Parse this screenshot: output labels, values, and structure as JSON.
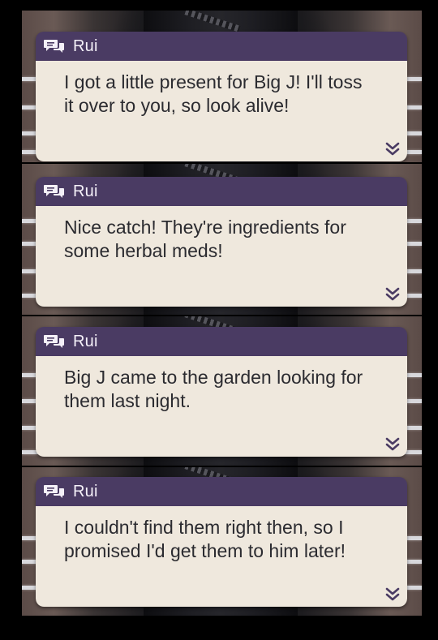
{
  "dialogs": [
    {
      "speaker": "Rui",
      "text": "I got a little present for Big J! I'll toss it over to you, so look alive!"
    },
    {
      "speaker": "Rui",
      "text": "Nice catch! They're ingredients for some herbal meds!"
    },
    {
      "speaker": "Rui",
      "text": "Big J came to the garden looking for them last night."
    },
    {
      "speaker": "Rui",
      "text": "I couldn't find them right then, so I promised I'd get them to him later!"
    }
  ],
  "icons": {
    "speaker": "chat-bubbles-icon",
    "advance": "double-chevron-down-icon"
  },
  "colors": {
    "header": "#4a3b63",
    "body": "#efe8dd",
    "text": "#2b2b30",
    "speaker_text": "#f4f0f8",
    "advance_icon": "#4a3b63"
  }
}
